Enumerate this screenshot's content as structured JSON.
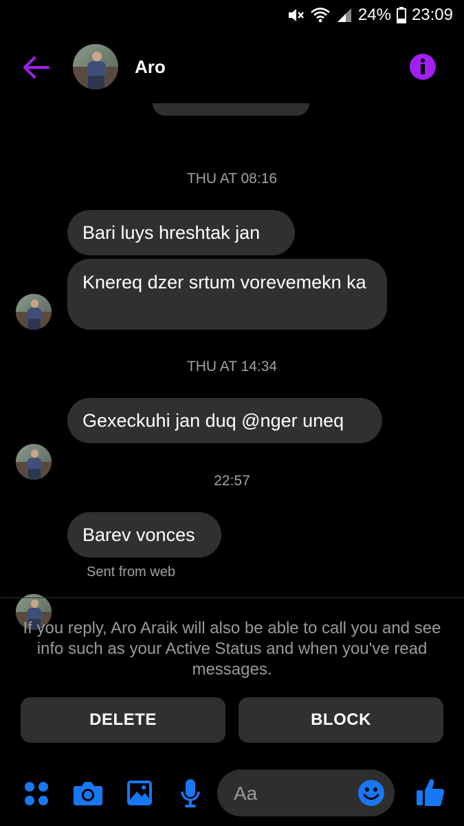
{
  "status_bar": {
    "battery": "24%",
    "time": "23:09"
  },
  "header": {
    "name": "Aro"
  },
  "messages": {
    "ts1": "THU AT 08:16",
    "msg1": "Bari luys hreshtak jan",
    "msg2": "Knereq dzer srtum vorevemekn ka",
    "ts2": "THU AT 14:34",
    "msg3": "Gexeckuhi jan duq @nger uneq",
    "ts3": "22:57",
    "msg4": "Barev vonces",
    "sent_from": "Sent from web"
  },
  "request": {
    "notice": "If you reply, Aro Araik will also be able to call you and see info such as your Active Status and when you've read messages.",
    "delete_label": "DELETE",
    "block_label": "BLOCK"
  },
  "composer": {
    "placeholder": "Aa"
  },
  "colors": {
    "accent": "#a020f0",
    "blue": "#1877f2",
    "bubble": "#303030"
  }
}
